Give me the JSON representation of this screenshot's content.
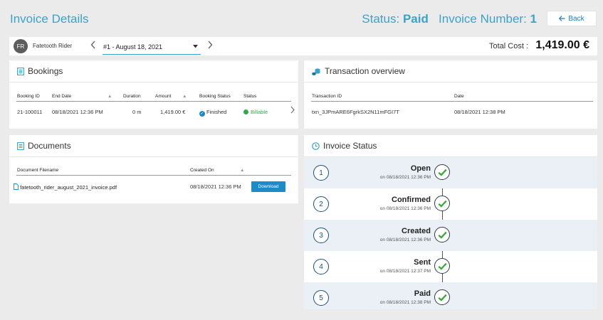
{
  "header": {
    "title": "Invoice Details",
    "status_label": "Status:",
    "status_value": "Paid",
    "invoice_number_label": "Invoice Number:",
    "invoice_number_value": "1",
    "back_label": "Back"
  },
  "toolbar": {
    "avatar_initials": "FR",
    "customer_name": "Fatetooth Rider",
    "invoice_selected": "#1 - August 18, 2021",
    "total_label": "Total Cost :",
    "total_value": "1,419.00 €"
  },
  "bookings": {
    "title": "Bookings",
    "columns": [
      "Booking ID",
      "End Date",
      "Duration",
      "Amount",
      "Booking Status",
      "Status"
    ],
    "rows": [
      {
        "booking_id": "21-100011",
        "end_date": "08/18/2021 12:36 PM",
        "duration": "0 m",
        "amount": "1,419.00 €",
        "booking_status": "Finished",
        "status": "Billable"
      }
    ]
  },
  "transactions": {
    "title": "Transaction overview",
    "columns": [
      "Transaction ID",
      "Date"
    ],
    "rows": [
      {
        "id": "txn_3JPmARE6FgrkSX2N11mFGI7T",
        "date": "08/18/2021 12:38 PM"
      }
    ]
  },
  "documents": {
    "title": "Documents",
    "columns": [
      "Document Filename",
      "Created On"
    ],
    "rows": [
      {
        "filename": "fatetooth_rider_august_2021_invoice.pdf",
        "created_on": "08/18/2021 12:36 PM",
        "action": "Download"
      }
    ]
  },
  "invoice_status": {
    "title": "Invoice Status",
    "steps": [
      {
        "num": "1",
        "label": "Open",
        "date": "on 08/18/2021 12:36 PM"
      },
      {
        "num": "2",
        "label": "Confirmed",
        "date": "on 08/18/2021 12:36 PM"
      },
      {
        "num": "3",
        "label": "Created",
        "date": "on 08/18/2021 12:36 PM"
      },
      {
        "num": "4",
        "label": "Sent",
        "date": "on 08/18/2021 12:37 PM"
      },
      {
        "num": "5",
        "label": "Paid",
        "date": "on 08/18/2021 12:38 PM"
      }
    ]
  },
  "colors": {
    "accent": "#3aa3c9",
    "primary_button": "#1d8ac9",
    "billable": "#2ea84a",
    "check": "#39a935",
    "step_shade": "#eaf0f5"
  },
  "icons": {
    "back": "arrow-left-icon",
    "bookings": "document-list-icon",
    "transactions": "coins-icon",
    "documents": "document-list-icon",
    "invoice_status": "clock-icon",
    "pdf": "file-icon",
    "step_done": "check-circle-icon"
  }
}
